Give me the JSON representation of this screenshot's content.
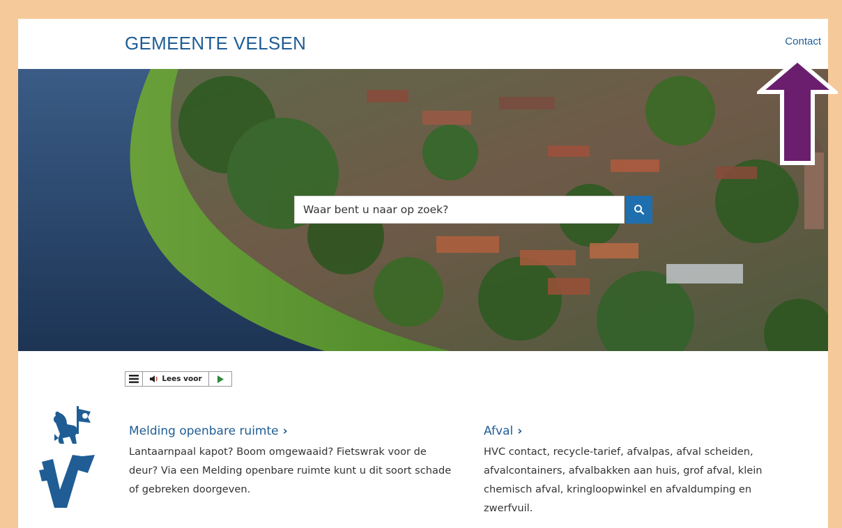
{
  "header": {
    "site_title": "GEMEENTE VELSEN",
    "contact_label": "Contact"
  },
  "search": {
    "placeholder": "Waar bent u naar op zoek?",
    "button_icon": "search-icon"
  },
  "readspeaker": {
    "menu_icon": "menu-icon",
    "speaker_icon": "speaker-icon",
    "label": "Lees voor",
    "play_icon": "play-icon"
  },
  "cards": [
    {
      "title": "Melding openbare ruimte",
      "chevron": "›",
      "text": "Lantaarnpaal kapot? Boom omgewaaid? Fietswrak voor de deur? Via een Melding openbare ruimte kunt u dit soort schade of gebreken doorgeven."
    },
    {
      "title": "Afval",
      "chevron": "›",
      "text": "HVC contact, recycle-tarief, afvalpas, afval scheiden, afvalcontainers, afvalbakken aan huis, grof afval, klein chemisch afval, kringloopwinkel en afvaldumping en zwerfvuil."
    }
  ],
  "colors": {
    "border": "#f6c99a",
    "brand_blue": "#1f5d94",
    "search_button": "#1f6fae",
    "annotation_arrow": "#6b1e6e"
  }
}
